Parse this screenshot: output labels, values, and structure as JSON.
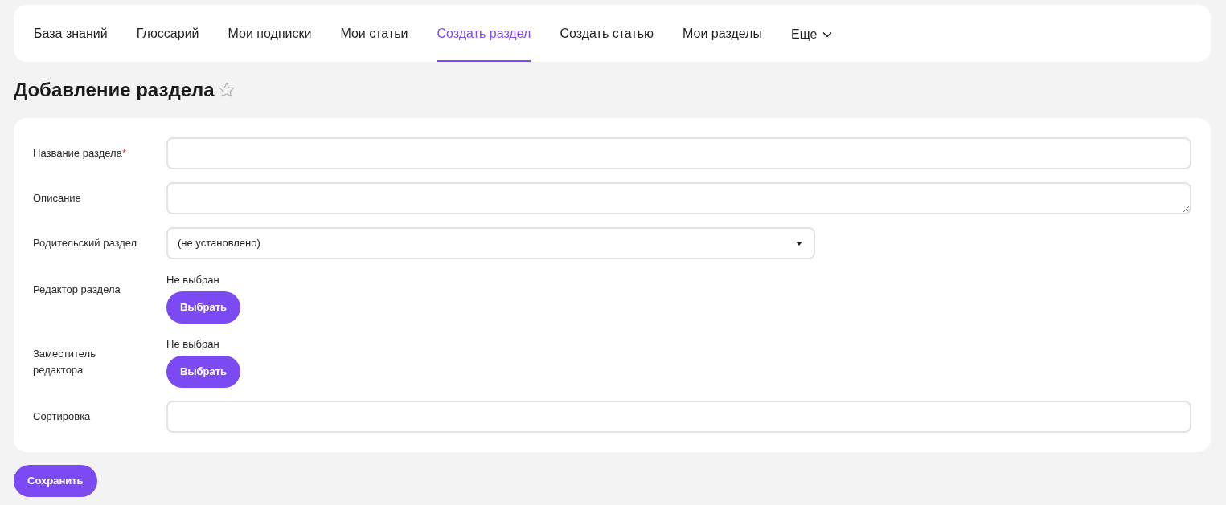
{
  "nav": {
    "tabs": [
      {
        "label": "База знаний",
        "selected": false
      },
      {
        "label": "Глоссарий",
        "selected": false
      },
      {
        "label": "Мои подписки",
        "selected": false
      },
      {
        "label": "Мои статьи",
        "selected": false
      },
      {
        "label": "Создать раздел",
        "selected": true
      },
      {
        "label": "Создать статью",
        "selected": false
      },
      {
        "label": "Мои разделы",
        "selected": false
      }
    ],
    "more": "Еще"
  },
  "page_title": "Добавление раздела",
  "favorite": false,
  "form": {
    "fields": [
      {
        "kind": "text",
        "label": "Название раздела",
        "required_mark": "*"
      },
      {
        "kind": "textarea",
        "label": "Описание"
      },
      {
        "kind": "select",
        "label": "Родительский раздел",
        "value": "(не установлено)"
      },
      {
        "kind": "picker",
        "label": "Редактор раздела",
        "value": "Не выбран",
        "button": "Выбрать"
      },
      {
        "kind": "picker",
        "label": "Заместитель редактора",
        "value": "Не выбран",
        "button": "Выбрать"
      },
      {
        "kind": "text",
        "label": "Сортировка"
      }
    ]
  },
  "save_button": "Сохранить"
}
